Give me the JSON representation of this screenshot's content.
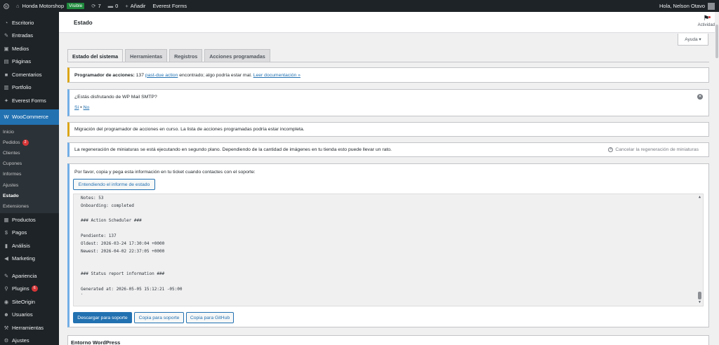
{
  "adminbar": {
    "site_name": "Honda Motorshop",
    "visible_badge": "Visible",
    "updates_count": "7",
    "comments_count": "0",
    "new_label": "Añadir",
    "everest_label": "Everest Forms",
    "greeting": "Hola, Nelson Otavo"
  },
  "sidebar": {
    "items_top": [
      {
        "label": "Escritorio",
        "icon": "dashboard-icon",
        "glyph": "◔"
      },
      {
        "label": "Entradas",
        "icon": "pin-icon",
        "glyph": "✎"
      },
      {
        "label": "Medios",
        "icon": "media-icon",
        "glyph": "▣"
      },
      {
        "label": "Páginas",
        "icon": "pages-icon",
        "glyph": "▤"
      },
      {
        "label": "Comentarios",
        "icon": "comments-icon",
        "glyph": "■"
      },
      {
        "label": "Portfolio",
        "icon": "portfolio-icon",
        "glyph": "▥"
      },
      {
        "label": "Everest Forms",
        "icon": "everest-icon",
        "glyph": "✦"
      }
    ],
    "woocommerce": {
      "label": "WooCommerce",
      "icon": "woo-icon",
      "glyph": "W"
    },
    "sub_items": [
      {
        "label": "Inicio"
      },
      {
        "label": "Pedidos",
        "badge": "2"
      },
      {
        "label": "Clientes"
      },
      {
        "label": "Cupones"
      },
      {
        "label": "Informes"
      },
      {
        "label": "Ajustes"
      },
      {
        "label": "Estado"
      },
      {
        "label": "Extensiones"
      }
    ],
    "items_bottom": [
      {
        "label": "Productos",
        "icon": "products-icon",
        "glyph": "▦"
      },
      {
        "label": "Pagos",
        "icon": "payments-icon",
        "glyph": "$"
      },
      {
        "label": "Análisis",
        "icon": "analytics-icon",
        "glyph": "▮"
      },
      {
        "label": "Marketing",
        "icon": "marketing-icon",
        "glyph": "◀"
      }
    ],
    "items_tail": [
      {
        "label": "Apariencia",
        "icon": "appearance-icon",
        "glyph": "✎"
      },
      {
        "label": "Plugins",
        "icon": "plugins-icon",
        "glyph": "⚲",
        "badge": "6"
      },
      {
        "label": "SiteOrigin",
        "icon": "siteorigin-icon",
        "glyph": "◉"
      },
      {
        "label": "Usuarios",
        "icon": "users-icon",
        "glyph": "☻"
      },
      {
        "label": "Herramientas",
        "icon": "tools-icon",
        "glyph": "⚒"
      },
      {
        "label": "Ajustes",
        "icon": "settings-icon",
        "glyph": "⚙"
      }
    ]
  },
  "header": {
    "title": "Estado",
    "activity_label": "Actividad",
    "help_label": "Ayuda ▾"
  },
  "tabs": [
    {
      "label": "Estado del sistema",
      "active": true
    },
    {
      "label": "Herramientas",
      "active": false
    },
    {
      "label": "Registros",
      "active": false
    },
    {
      "label": "Acciones programadas",
      "active": false
    }
  ],
  "notices": {
    "scheduler_bold": "Programador de acciones:",
    "scheduler_text": " 137 ",
    "scheduler_link": "past-due action",
    "scheduler_text2": " encontrado; algo podría estar mal. ",
    "scheduler_doc_link": "Leer documentación »",
    "smtp_question": "¿Estás disfrutando de WP Mail SMTP?",
    "smtp_yes": "Sí",
    "smtp_sep": " • ",
    "smtp_no": "No",
    "migration_text": "Migración del programador de acciones en curso. La lista de acciones programadas podría estar incompleta.",
    "regen_text": "La regeneración de miniaturas se está ejecutando en segundo plano. Dependiendo de la cantidad de imágenes en tu tienda esto puede llevar un rato.",
    "regen_cancel": "Cancelar la regeneración de miniaturas"
  },
  "support": {
    "intro": "Por favor, copia y pega esta información en tu ticket cuando contactes con el soporte:",
    "understand_button": "Entendiendo el informe de estado",
    "report_lines": [
      "Notes: 53",
      "Onboarding: completed",
      "",
      "### Action Scheduler ###",
      "",
      "Pendiente: 137",
      "Oldest: 2026-03-24 17:30:04 +0000",
      "Newest: 2026-04-02 22:37:05 +0000",
      "",
      "",
      "### Status report information ###",
      "",
      "Generated at: 2026-05-05 15:12:21 -05:00",
      "`"
    ],
    "download_button": "Descargar para soporte",
    "copy_support_button": "Copia para soporte",
    "copy_github_button": "Copia para GitHub"
  },
  "environment": {
    "title": "Entorno WordPress"
  }
}
